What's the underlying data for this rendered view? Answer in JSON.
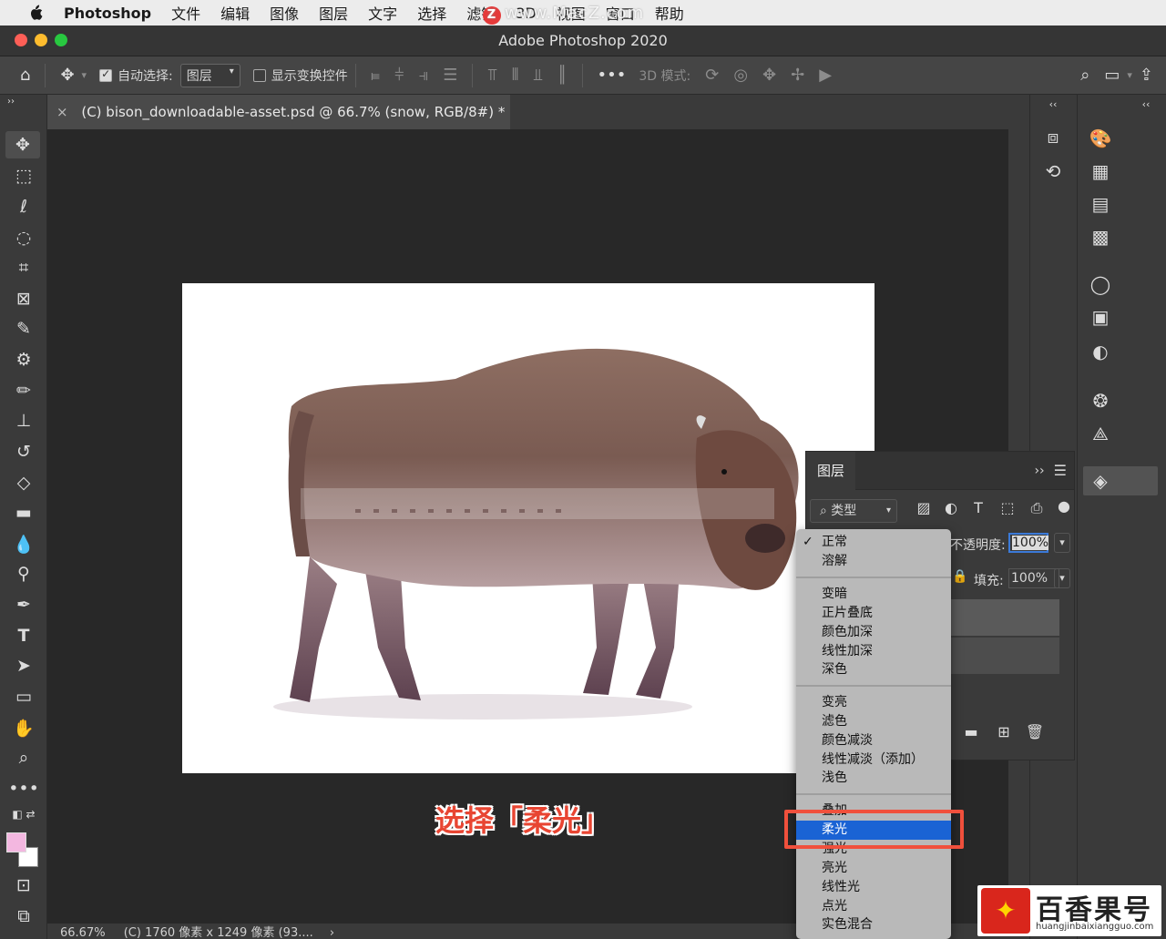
{
  "menubar": {
    "app_name": "Photoshop",
    "items": [
      "文件",
      "编辑",
      "图像",
      "图层",
      "文字",
      "选择",
      "滤镜",
      "3D",
      "视图",
      "窗口",
      "帮助"
    ],
    "watermark": "www.MacZ.com"
  },
  "window": {
    "title": "Adobe Photoshop 2020"
  },
  "options_bar": {
    "auto_select_label": "自动选择:",
    "auto_select_checked": true,
    "target_value": "图层",
    "show_transform_label": "显示变换控件",
    "show_transform_checked": false,
    "mode_3d_label": "3D 模式:"
  },
  "document": {
    "tab_title": "(C) bison_downloadable-asset.psd @ 66.7% (snow, RGB/8#) *",
    "close_symbol": "×"
  },
  "status_bar": {
    "zoom": "66.67%",
    "info": "(C) 1760 像素 x 1249 像素 (93....",
    "arrow": "›"
  },
  "caption": "选择「柔光」",
  "layers_panel": {
    "tab_label": "图层",
    "filter_label": "类型",
    "opacity_label": "不透明度:",
    "opacity_value": "100%",
    "fill_label": "填充:",
    "fill_value": "100%"
  },
  "blend_menu": {
    "groups": [
      [
        "正常",
        "溶解"
      ],
      [
        "变暗",
        "正片叠底",
        "颜色加深",
        "线性加深",
        "深色"
      ],
      [
        "变亮",
        "滤色",
        "颜色减淡",
        "线性减淡（添加）",
        "浅色"
      ],
      [
        "叠加",
        "柔光",
        "强光",
        "亮光",
        "线性光",
        "点光",
        "实色混合"
      ]
    ],
    "checked": "正常",
    "highlighted": "柔光"
  },
  "colors": {
    "highlight": "#1a63d4",
    "annotation_red": "#f0503c",
    "foreground_swatch": "#f3b7e0",
    "background_swatch": "#ffffff"
  },
  "watermark": {
    "text": "百香果号",
    "url": "huangjinbaixiangguo.com"
  },
  "icons": {
    "toolbar": [
      "move-icon",
      "marquee-icon",
      "lasso-icon",
      "quick-select-icon",
      "crop-icon",
      "frame-icon",
      "eyedropper-icon",
      "healing-icon",
      "brush-icon",
      "stamp-icon",
      "history-brush-icon",
      "eraser-icon",
      "gradient-icon",
      "blur-icon",
      "dodge-icon",
      "pen-icon",
      "type-icon",
      "path-select-icon",
      "rectangle-icon",
      "hand-icon",
      "zoom-icon",
      "more-icon"
    ]
  }
}
